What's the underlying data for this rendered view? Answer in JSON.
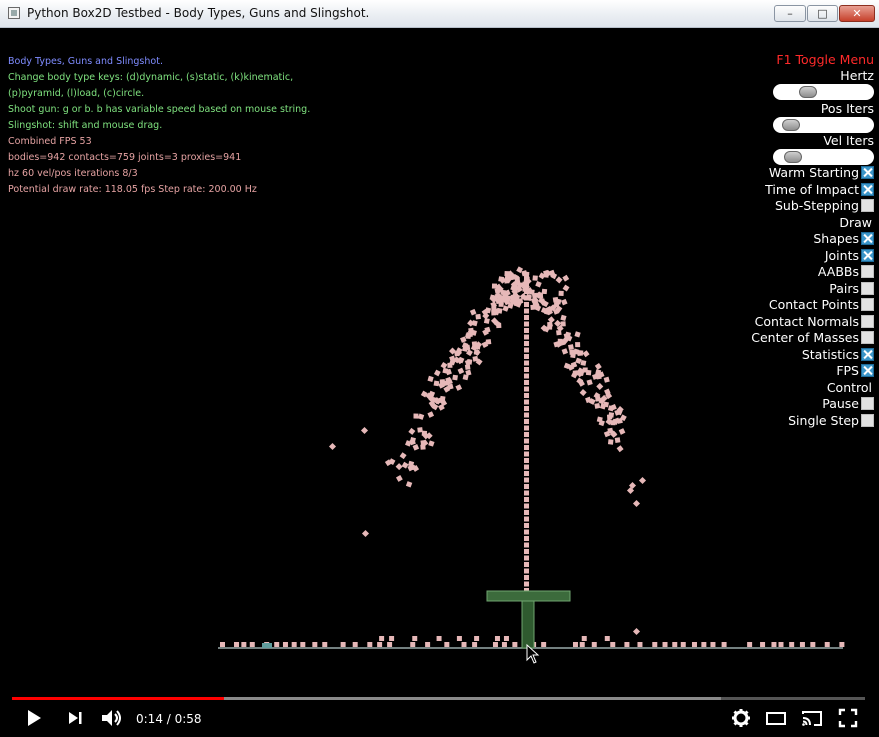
{
  "window": {
    "title": "Python Box2D Testbed - Body Types, Guns and Slingshot.",
    "min_label": "–",
    "max_label": "□",
    "close_label": "✕"
  },
  "info": {
    "lines": [
      "Body Types, Guns and Slingshot.",
      "Change body type keys: (d)dynamic, (s)static, (k)kinematic,",
      "(p)pyramid, (l)load, (c)circle.",
      "Shoot gun: g or b. b has variable speed based on mouse string.",
      "Slingshot: shift and mouse drag.",
      "Combined FPS 53",
      "bodies=942 contacts=759 joints=3 proxies=941",
      "hz 60 vel/pos iterations 8/3",
      "Potential draw rate: 118.05 fps Step rate: 200.00 Hz"
    ]
  },
  "gui": {
    "toggle_menu": "F1  Toggle Menu",
    "hertz": {
      "label": "Hertz",
      "level": 0.3
    },
    "pos_iters": {
      "label": "Pos Iters",
      "level": 0.08
    },
    "vel_iters": {
      "label": "Vel Iters",
      "level": 0.1
    },
    "checks": [
      {
        "label": "Warm Starting",
        "checked": true
      },
      {
        "label": "Time of Impact",
        "checked": true
      },
      {
        "label": "Sub-Stepping",
        "checked": false
      },
      {
        "label": "Draw",
        "header": true
      },
      {
        "label": "Shapes",
        "checked": true
      },
      {
        "label": "Joints",
        "checked": true
      },
      {
        "label": "AABBs",
        "checked": false
      },
      {
        "label": "Pairs",
        "checked": false
      },
      {
        "label": "Contact Points",
        "checked": false
      },
      {
        "label": "Contact Normals",
        "checked": false
      },
      {
        "label": "Center of Masses",
        "checked": false
      },
      {
        "label": "Statistics",
        "checked": true
      },
      {
        "label": "FPS",
        "checked": true
      },
      {
        "label": "Control",
        "header": true
      },
      {
        "label": "Pause",
        "checked": false
      },
      {
        "label": "Single Step",
        "checked": false
      }
    ]
  },
  "colors": {
    "body": "#e6b8b8",
    "static": "#7fb07f",
    "ground": "#9aa",
    "accent": "#ff0000"
  },
  "player": {
    "time": "0:14 / 0:58",
    "progress": 0.2486,
    "buffered": 0.831,
    "icons": [
      "play-icon",
      "next-icon",
      "volume-icon",
      "settings-icon",
      "theater-icon",
      "cast-icon",
      "fullscreen-icon"
    ]
  }
}
